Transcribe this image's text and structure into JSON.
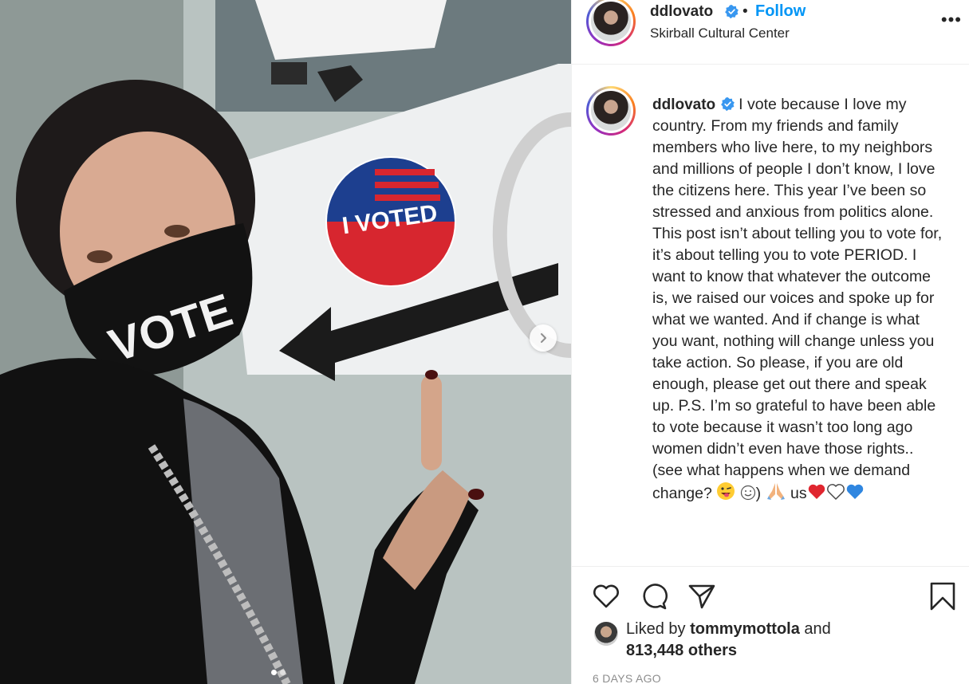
{
  "post": {
    "username": "ddlovato",
    "follow_label": "Follow",
    "separator": "•",
    "location": "Skirball Cultural Center",
    "more_label": "•••",
    "caption_text": "I vote because I love my country. From my friends and family members who live here, to my neighbors and millions of people I don’t know, I love the citizens here. This year I’ve been so stressed and anxious from politics alone. This post isn’t about telling you to vote for, it’s about telling you to vote PERIOD. I want to know that whatever the outcome is, we raised our voices and spoke up for what we wanted. And if change is what you want, nothing will change unless you take action. So please, if you are old enough, please get out there and speak up. P.S. I’m so grateful to have been able to vote because it wasn’t too long ago women didn’t even have those rights.. (see what happens when we demand change?",
    "caption_end_text": ")",
    "caption_us_text": "us"
  },
  "photo": {
    "sticker_text": "I VOTED",
    "mask_text": "VOTE",
    "carousel_count": 2,
    "carousel_active_index": 0
  },
  "likes": {
    "prefix": "Liked by ",
    "user": "tommymottola",
    "and_text": " and",
    "others": "813,448 others"
  },
  "timestamp": "6 DAYS AGO",
  "colors": {
    "follow_blue": "#0095f6",
    "verified_blue": "#3897f0",
    "text": "#262626",
    "muted": "#8e8e8e"
  },
  "icons": {
    "like": "heart-icon",
    "comment": "comment-icon",
    "share": "share-icon",
    "save": "bookmark-icon",
    "next": "chevron-right-icon"
  }
}
